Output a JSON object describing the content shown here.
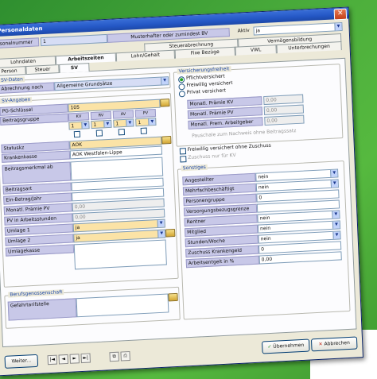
{
  "window": {
    "title": "Personaldaten"
  },
  "header": {
    "personalnummer_label": "Personalnummer",
    "personalnummer_value": "1",
    "name_value": "Musterhafter oder zumindest BV",
    "aktiv_label": "Aktiv",
    "aktiv_value": "ja"
  },
  "tabs_row1": [
    "Steuerabrechnung",
    "Vermögensbildung"
  ],
  "tabs_row2": [
    "Lohndaten",
    "Arbeitszeiten",
    "Lohn/Gehalt",
    "Fixe Bezüge",
    "VWL",
    "Unterbrechungen"
  ],
  "tabs_row3": [
    "Person",
    "Steuer",
    "SV"
  ],
  "sv_section": {
    "title": "SV-Daten",
    "abrechnung_label": "Abrechnung nach",
    "abrechnung_value": "Allgemeine Grundsätze",
    "angaben_title": "SV-Angaben",
    "rows": [
      {
        "label": "PG-Schlüssel",
        "value": "105",
        "type": "yellow"
      },
      {
        "label": "Beitragsgruppe",
        "value": "",
        "type": "white"
      },
      {
        "label": "Statuskz",
        "value": "AOK",
        "type": "yellow"
      },
      {
        "label": "Krankenkasse",
        "value": "AOK Westfalen-Lippe",
        "type": "white"
      },
      {
        "label": "Beitragsmerkmal ab",
        "value": "",
        "type": "white"
      },
      {
        "label": "Beitragsart",
        "value": "",
        "type": "white"
      },
      {
        "label": "Ein-Betrag/Jahr",
        "value": "",
        "type": "white"
      },
      {
        "label": "Monatl. Prämie PV",
        "value": "0,00",
        "type": "grey"
      },
      {
        "label": "PV in Arbeitsstunden",
        "value": "0,00",
        "type": "grey"
      },
      {
        "label": "Umlage 1",
        "value": "ja",
        "type": "yellow"
      },
      {
        "label": "Umlage 2",
        "value": "ja",
        "type": "yellow"
      },
      {
        "label": "Umlagekasse",
        "value": "",
        "type": "white"
      }
    ],
    "beitrag_columns": [
      "KV",
      "RV",
      "AV",
      "PV"
    ],
    "beitrag_values": [
      "1",
      "1",
      "1",
      "1"
    ]
  },
  "versicherung": {
    "title": "Versicherungsfreiheit",
    "options": [
      {
        "label": "Pflichtversichert",
        "on": true
      },
      {
        "label": "Freiwillig versichert",
        "on": false
      },
      {
        "label": "Privat versichert",
        "on": false
      }
    ],
    "premium_rows": [
      {
        "label": "Monatl. Prämie KV",
        "value": "0,00"
      },
      {
        "label": "Monatl. Prämie PV",
        "value": "0,00"
      },
      {
        "label": "Monatl. Prem. Arbeitgeber",
        "value": "0,00"
      }
    ],
    "check1": "Freiwillig versichert ohne Zuschuss",
    "check2": "Zuschuss nur für KV",
    "note": "Pauschale zum Nachweis ohne Beitragssatz"
  },
  "sonstiges": {
    "title": "Sonstiges",
    "rows": [
      {
        "label": "Angestellter",
        "value": "nein"
      },
      {
        "label": "Mehrfachbeschäftigt",
        "value": "nein"
      },
      {
        "label": "Personengruppe",
        "value": "0"
      },
      {
        "label": "Versorgungsbezugsgrenze",
        "value": ""
      },
      {
        "label": "Rentner",
        "value": "nein"
      },
      {
        "label": "Mitglied",
        "value": "nein"
      },
      {
        "label": "Stunden/Woche",
        "value": "nein"
      },
      {
        "label": "Zuschuss Krankengeld",
        "value": "0"
      },
      {
        "label": "Arbeitsentgelt in %",
        "value": "0,00"
      }
    ]
  },
  "berufsgenossenschaft": {
    "title": "Berufsgenossenschaft",
    "label": "Gefahrtarifstelle",
    "value": ""
  },
  "footer": {
    "weiter_label": "Weiter...",
    "nav_labels": [
      "|◄",
      "◄",
      "►",
      "►|"
    ],
    "ok_label": "Übernehmen",
    "cancel_label": "Abbrechen"
  }
}
